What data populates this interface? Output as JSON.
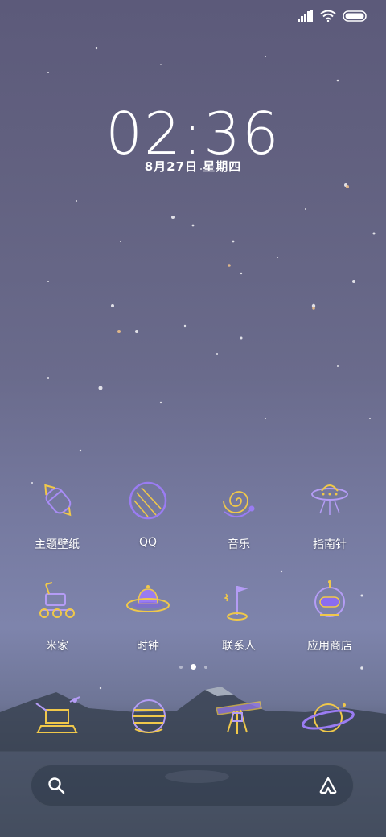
{
  "status_bar": {
    "icons": [
      "signal-icon",
      "wifi-icon",
      "battery-icon"
    ]
  },
  "lock": {
    "time": "02:36",
    "date": "8月27日  星期四"
  },
  "apps": [
    {
      "label": "主题壁纸",
      "icon": "rocket-icon"
    },
    {
      "label": "QQ",
      "icon": "planet-icon"
    },
    {
      "label": "音乐",
      "icon": "spiral-galaxy-icon"
    },
    {
      "label": "指南针",
      "icon": "ufo-beam-icon"
    },
    {
      "label": "米家",
      "icon": "rover-icon"
    },
    {
      "label": "时钟",
      "icon": "ufo-dome-icon"
    },
    {
      "label": "联系人",
      "icon": "flag-icon"
    },
    {
      "label": "应用商店",
      "icon": "astronaut-helmet-icon"
    }
  ],
  "pager": {
    "count": 3,
    "active": 1
  },
  "dock": [
    "satellite-icon",
    "striped-planet-icon",
    "telescope-icon",
    "ringed-planet-icon"
  ],
  "search": {
    "left_icon": "search-icon",
    "right_icon": "assistant-icon"
  },
  "colors": {
    "accent_purple": "#8a6cf0",
    "accent_gold": "#f0c84a"
  }
}
